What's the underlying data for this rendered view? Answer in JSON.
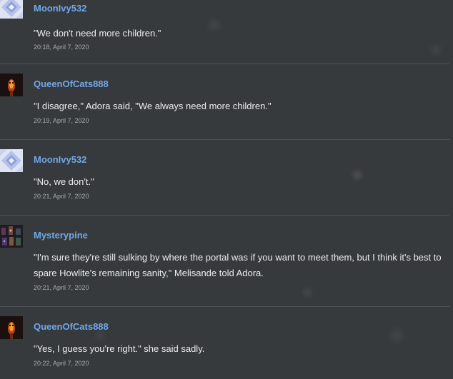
{
  "comments": [
    {
      "username": "MoonIvy532",
      "avatar_icon": "moonivy-avatar-icon",
      "message": "\"We don't need more children.\"",
      "timestamp": "20:18, April 7, 2020"
    },
    {
      "username": "QueenOfCats888",
      "avatar_icon": "queenofcats-avatar-icon",
      "message": "\"I disagree,\" Adora said, \"We always need more children.\"",
      "timestamp": "20:19, April 7, 2020"
    },
    {
      "username": "MoonIvy532",
      "avatar_icon": "moonivy-avatar-icon",
      "message": "\"No, we don't.\"",
      "timestamp": "20:21, April 7, 2020"
    },
    {
      "username": "Mysterypine",
      "avatar_icon": "mysterypine-avatar-icon",
      "message": "\"I'm sure they're still sulking by where the portal was if you want to meet them, but I think it's best to spare Howlite's remaining sanity,\" Melisande told Adora.",
      "timestamp": "20:21, April 7, 2020"
    },
    {
      "username": "QueenOfCats888",
      "avatar_icon": "queenofcats-avatar-icon",
      "message": "\"Yes, I guess you're right.\" she said sadly.",
      "timestamp": "20:22, April 7, 2020"
    }
  ],
  "colors": {
    "background": "#373a3d",
    "username": "#6fa8e8",
    "message": "#ececec",
    "timestamp": "#a8abad",
    "divider": "#4e5256"
  }
}
